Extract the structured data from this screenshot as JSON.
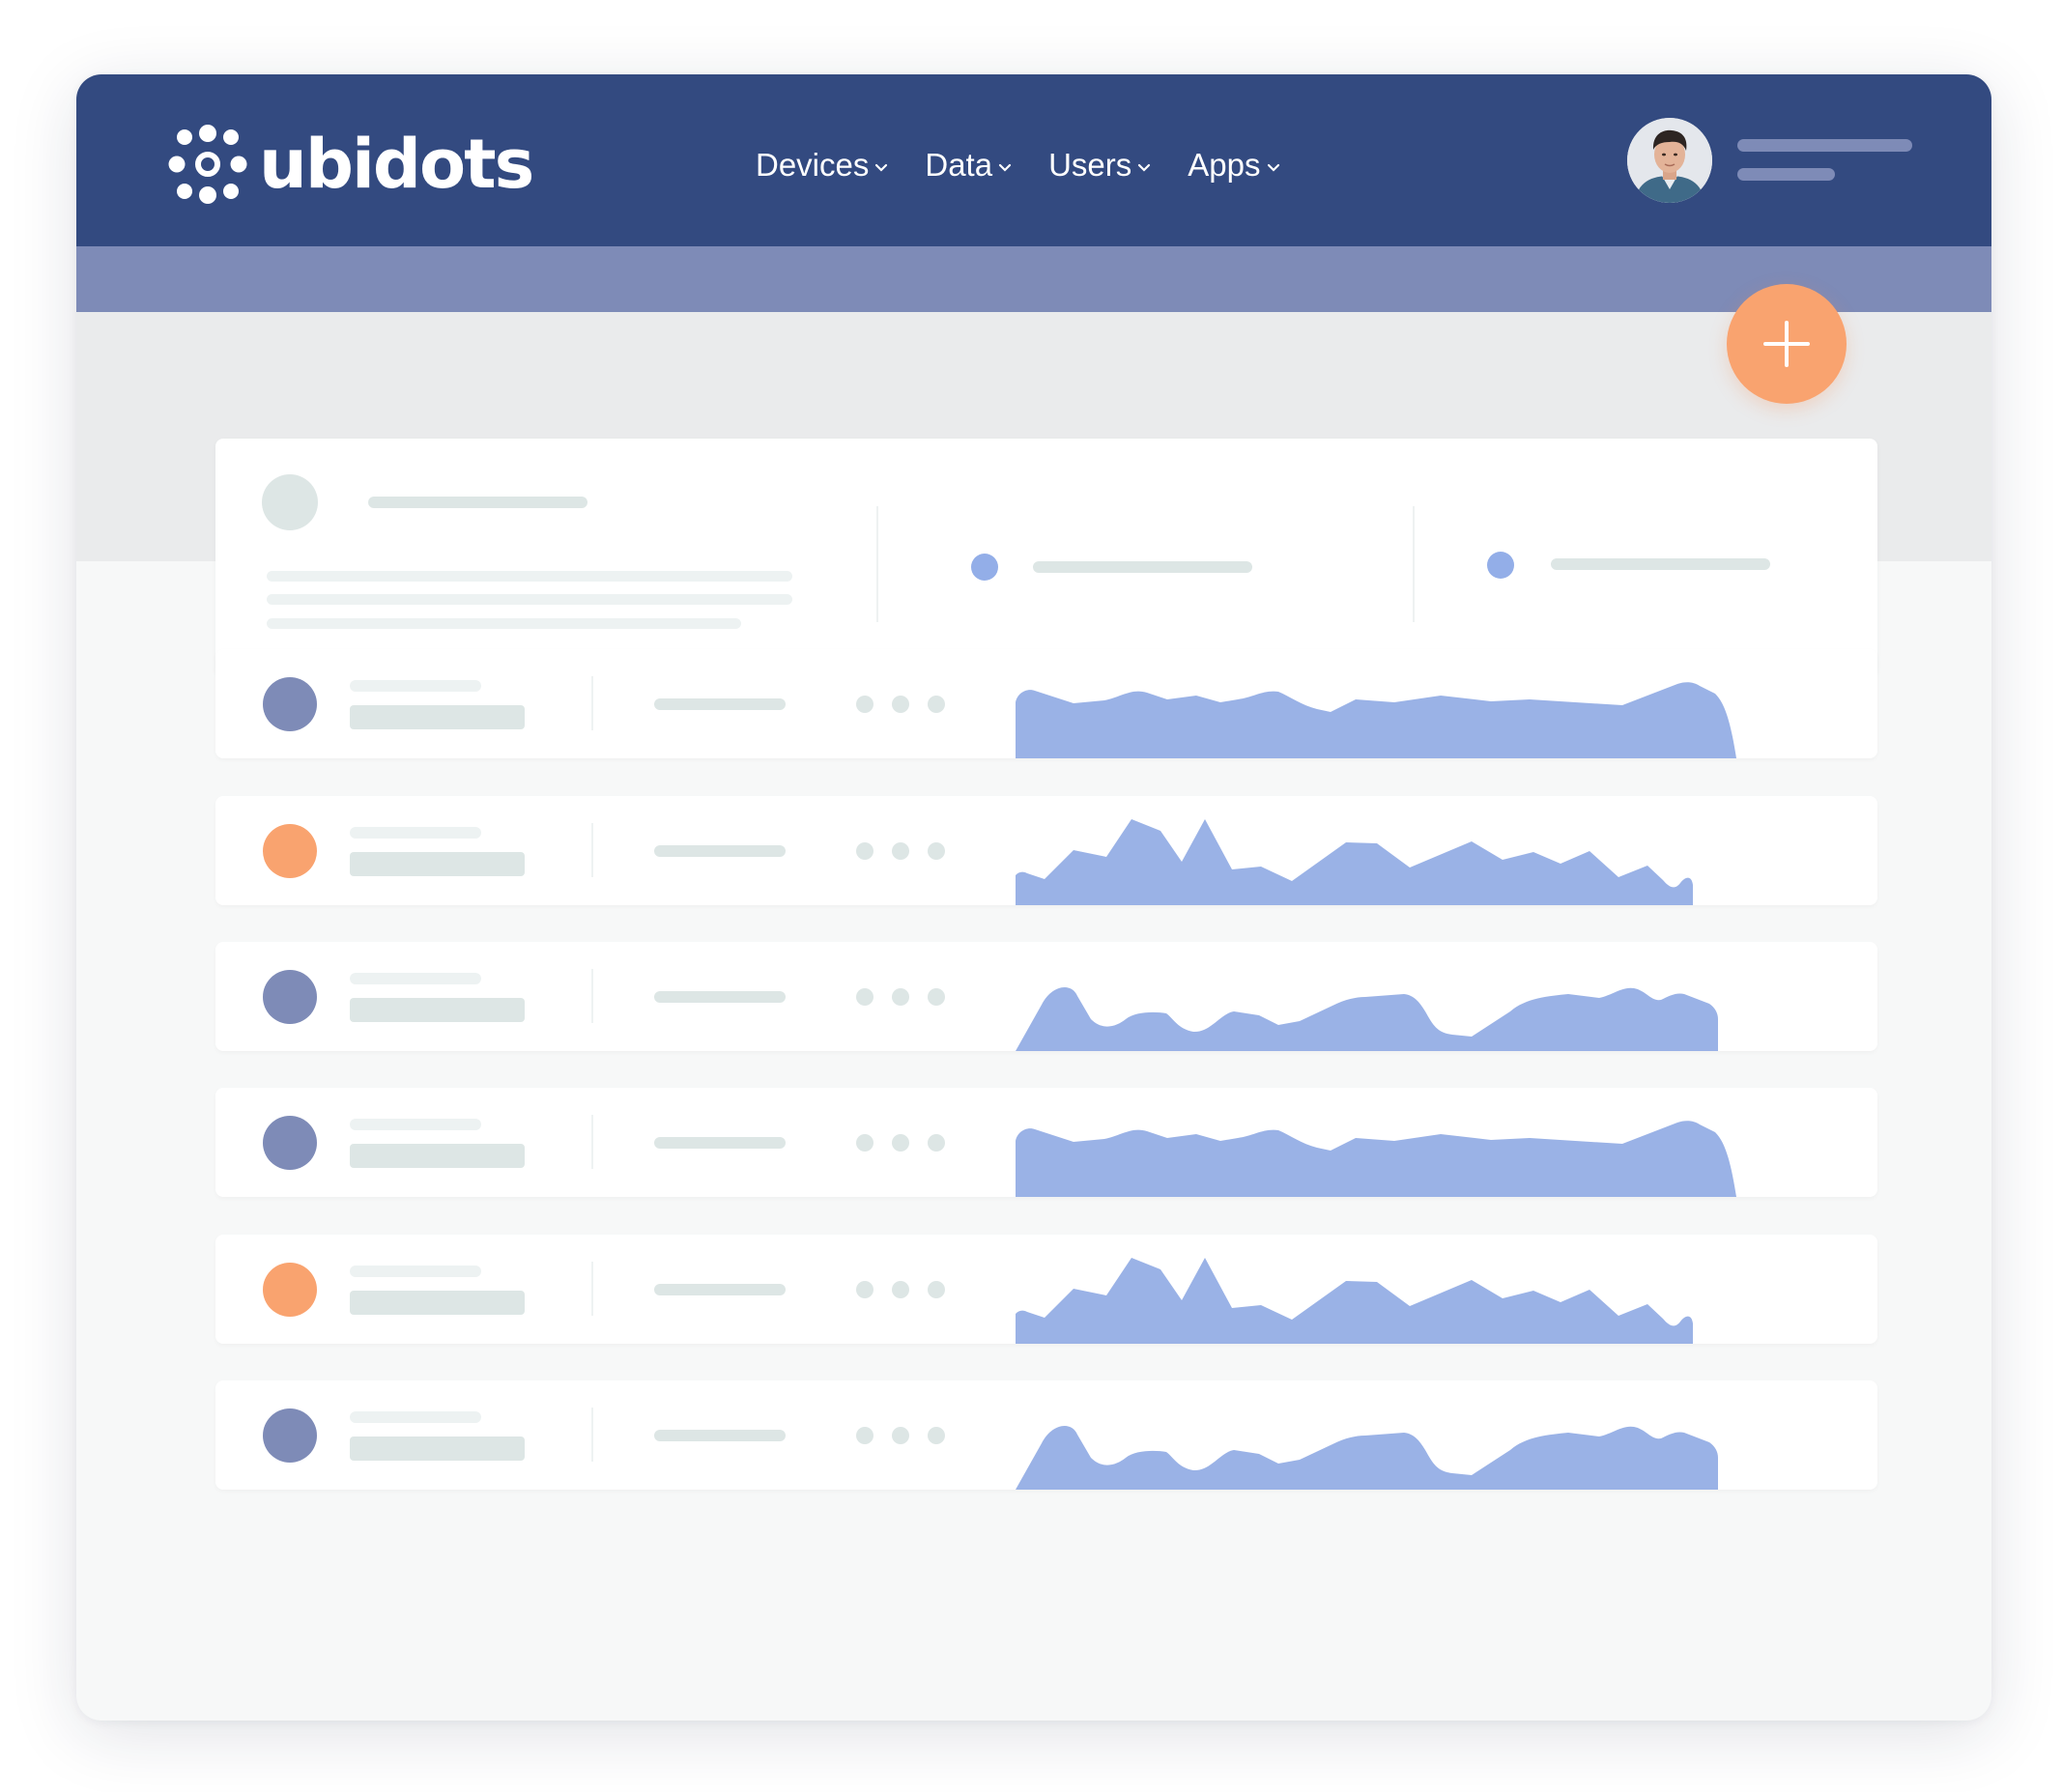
{
  "brand": {
    "name": "ubidots"
  },
  "nav": {
    "items": [
      {
        "label": "Devices"
      },
      {
        "label": "Data"
      },
      {
        "label": "Users"
      },
      {
        "label": "Apps"
      }
    ]
  },
  "colors": {
    "header": "#334a80",
    "subheader": "#7e8bb7",
    "accent_orange": "#f9a36f",
    "accent_blue": "#93aee8",
    "device_purple": "#7e8bb7",
    "chart_fill": "#9ab2e6"
  },
  "icons": {
    "fab": "plus-icon",
    "nav_chevron": "chevron-down-icon",
    "brand": "ubidots-logo-icon"
  },
  "device_rows": [
    {
      "status_color": "#7e8bb7",
      "sparkline": "wave-a"
    },
    {
      "status_color": "#f9a36f",
      "sparkline": "wave-b"
    },
    {
      "status_color": "#7e8bb7",
      "sparkline": "wave-c"
    },
    {
      "status_color": "#7e8bb7",
      "sparkline": "wave-a"
    },
    {
      "status_color": "#f9a36f",
      "sparkline": "wave-b"
    },
    {
      "status_color": "#7e8bb7",
      "sparkline": "wave-c"
    }
  ]
}
